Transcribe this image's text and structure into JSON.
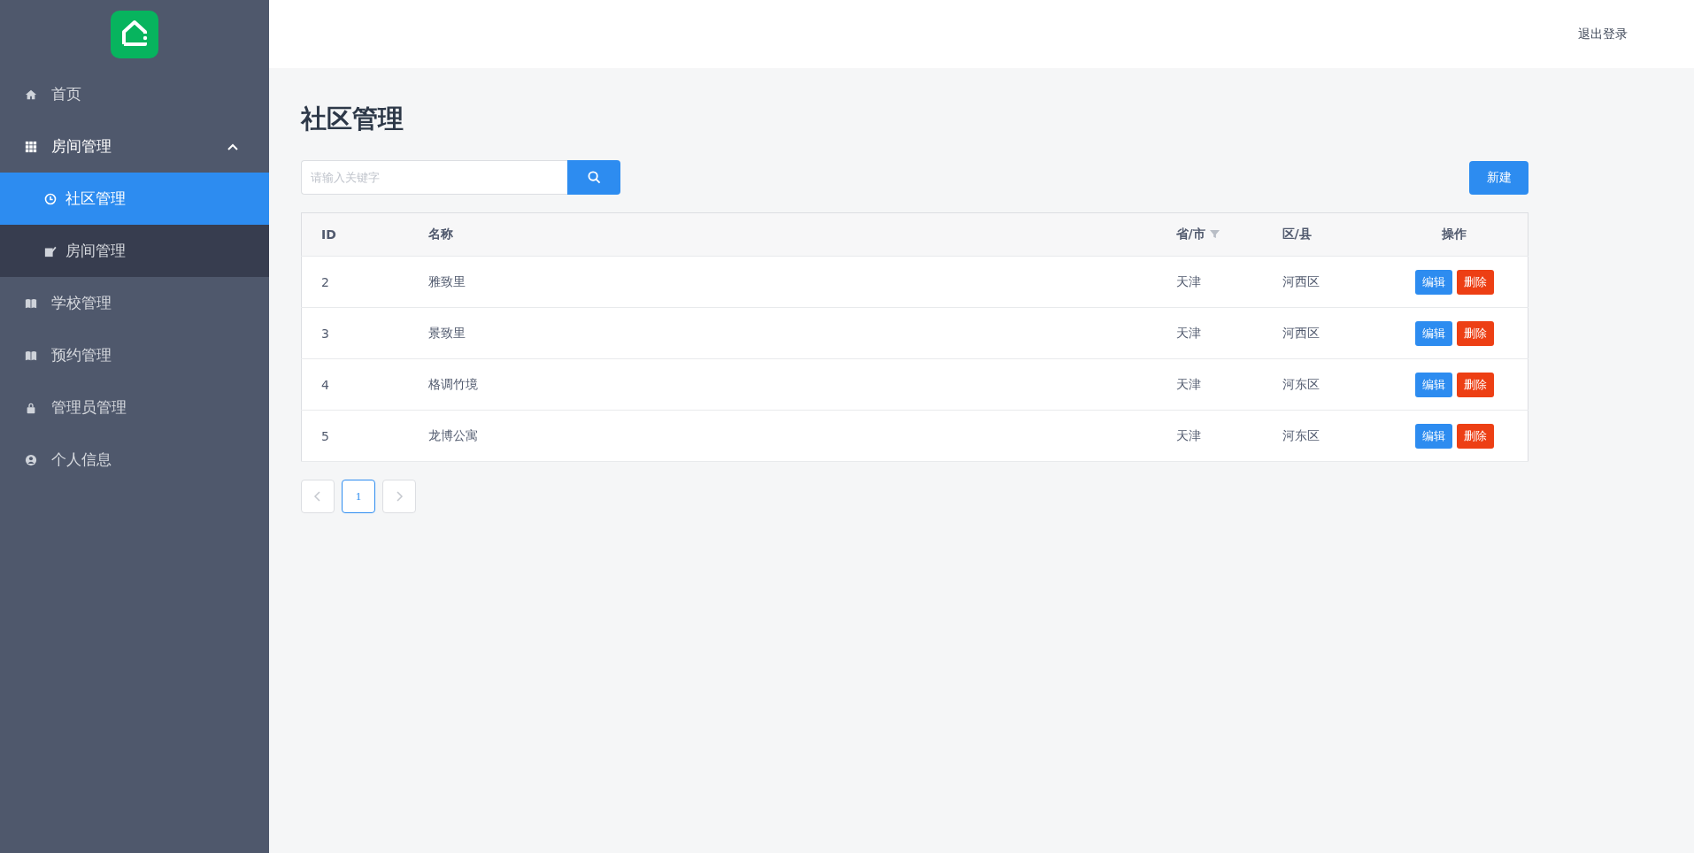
{
  "sidebar": {
    "items": [
      {
        "label": "首页",
        "selected": false
      },
      {
        "label": "房间管理",
        "selected": false,
        "expanded": true,
        "children": [
          {
            "label": "社区管理",
            "selected": true
          },
          {
            "label": "房间管理",
            "selected": false
          }
        ]
      },
      {
        "label": "学校管理",
        "selected": false
      },
      {
        "label": "预约管理",
        "selected": false
      },
      {
        "label": "管理员管理",
        "selected": false
      },
      {
        "label": "个人信息",
        "selected": false
      }
    ]
  },
  "header": {
    "logout": "退出登录"
  },
  "page": {
    "title": "社区管理"
  },
  "search": {
    "placeholder": "请输入关键字"
  },
  "new_button": "新建",
  "table": {
    "columns": [
      {
        "label": "ID",
        "filterable": false
      },
      {
        "label": "名称",
        "filterable": false
      },
      {
        "label": "省/市",
        "filterable": true
      },
      {
        "label": "区/县",
        "filterable": false
      },
      {
        "label": "操作",
        "filterable": false
      }
    ],
    "rows": [
      {
        "id": "2",
        "name": "雅致里",
        "province": "天津",
        "district": "河西区",
        "actions": [
          {
            "label": "编辑",
            "kind": "primary"
          },
          {
            "label": "删除",
            "kind": "danger"
          }
        ]
      },
      {
        "id": "3",
        "name": "景致里",
        "province": "天津",
        "district": "河西区",
        "actions": [
          {
            "label": "编辑",
            "kind": "primary"
          },
          {
            "label": "删除",
            "kind": "danger"
          }
        ]
      },
      {
        "id": "4",
        "name": "格调竹境",
        "province": "天津",
        "district": "河东区",
        "actions": [
          {
            "label": "编辑",
            "kind": "primary"
          },
          {
            "label": "删除",
            "kind": "danger"
          }
        ]
      },
      {
        "id": "5",
        "name": "龙博公寓",
        "province": "天津",
        "district": "河东区",
        "actions": [
          {
            "label": "编辑",
            "kind": "primary"
          },
          {
            "label": "删除",
            "kind": "danger"
          }
        ]
      }
    ]
  },
  "pagination": {
    "pages": [
      {
        "label": "1",
        "selected": true
      }
    ]
  }
}
